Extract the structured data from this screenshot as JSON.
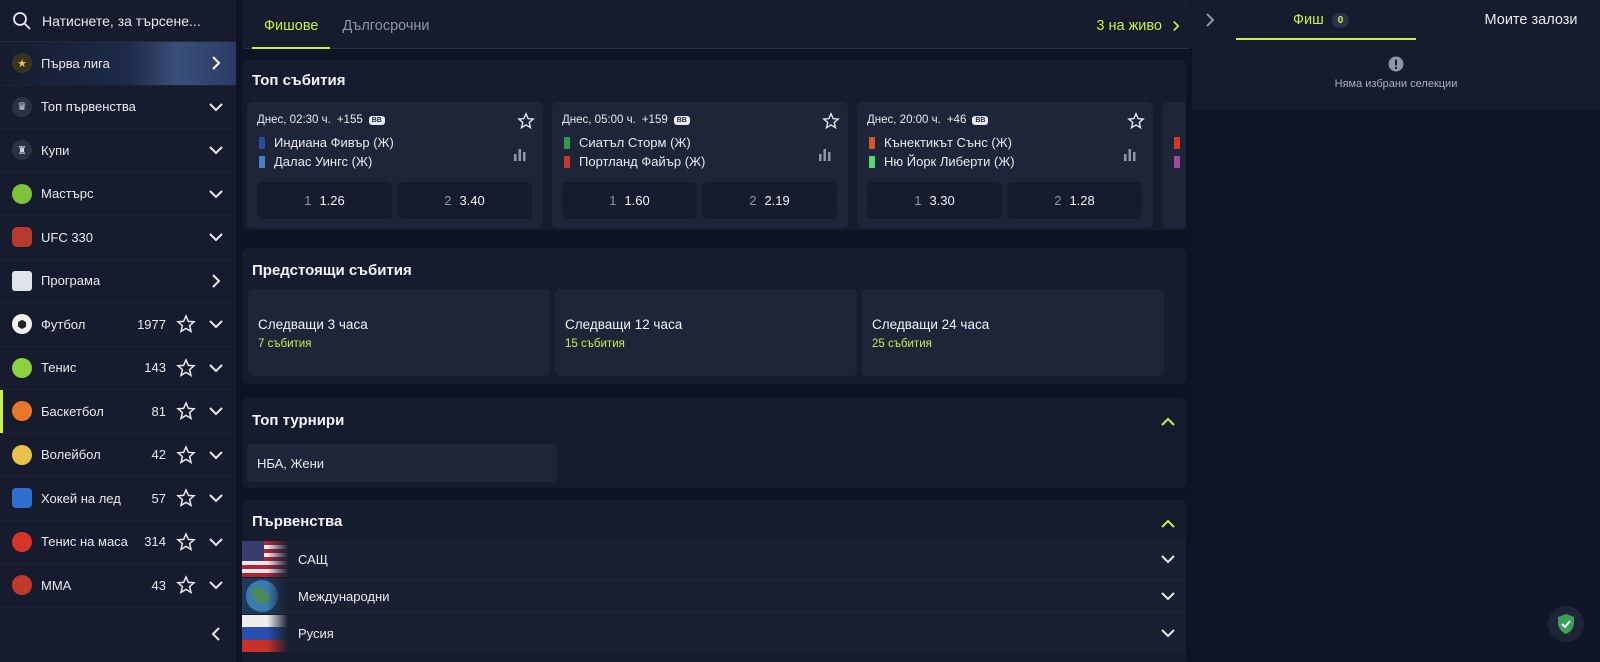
{
  "search": {
    "placeholder": "Натиснете, за търсене..."
  },
  "sidebar": {
    "items": [
      {
        "label": "Първа лига",
        "count": ""
      },
      {
        "label": "Топ първенства",
        "count": ""
      },
      {
        "label": "Купи",
        "count": ""
      },
      {
        "label": "Мастърс",
        "count": ""
      },
      {
        "label": "UFC 330",
        "count": ""
      },
      {
        "label": "Програма",
        "count": ""
      },
      {
        "label": "Футбол",
        "count": "1977"
      },
      {
        "label": "Тенис",
        "count": "143"
      },
      {
        "label": "Баскетбол",
        "count": "81"
      },
      {
        "label": "Волейбол",
        "count": "42"
      },
      {
        "label": "Хокей на лед",
        "count": "57"
      },
      {
        "label": "Тенис на маса",
        "count": "314"
      },
      {
        "label": "MMA",
        "count": "43"
      }
    ]
  },
  "tabs": {
    "slips": "Фишове",
    "longterm": "Дългосрочни",
    "live": "3 на живо"
  },
  "top_events": {
    "title": "Топ събития",
    "events": [
      {
        "time": "Днес, 02:30 ч.",
        "markets": "+155",
        "bb": "BB",
        "home": "Индиана Фивър (Ж)",
        "away": "Далас Уингс (Ж)",
        "odd1_sel": "1",
        "odd1": "1.26",
        "odd2_sel": "2",
        "odd2": "3.40"
      },
      {
        "time": "Днес, 05:00 ч.",
        "markets": "+159",
        "bb": "BB",
        "home": "Сиатъл Сторм (Ж)",
        "away": "Портланд Файър (Ж)",
        "odd1_sel": "1",
        "odd1": "1.60",
        "odd2_sel": "2",
        "odd2": "2.19"
      },
      {
        "time": "Днес, 20:00 ч.",
        "markets": "+46",
        "bb": "BB",
        "home": "Кънектикът Сънс (Ж)",
        "away": "Ню Йорк Либерти (Ж)",
        "odd1_sel": "1",
        "odd1": "3.30",
        "odd2_sel": "2",
        "odd2": "1.28"
      }
    ]
  },
  "upcoming": {
    "title": "Предстоящи събития",
    "cards": [
      {
        "title": "Следващи 3 часа",
        "sub": "7 събития"
      },
      {
        "title": "Следващи 12 часа",
        "sub": "15 събития"
      },
      {
        "title": "Следващи 24 часа",
        "sub": "25 събития"
      }
    ]
  },
  "top_tournaments": {
    "title": "Топ турнири",
    "items": [
      "НБА, Жени"
    ]
  },
  "championships": {
    "title": "Първенства",
    "countries": [
      "САЩ",
      "Международни",
      "Русия"
    ]
  },
  "betslip": {
    "tab_slip": "Фиш",
    "slip_count": "0",
    "tab_mybets": "Моите залози",
    "empty": "Няма избрани селекции"
  },
  "colors": {
    "accent": "#c8f04a",
    "bg": "#0f1424",
    "panel": "#161c2e",
    "card": "#1e2538"
  }
}
